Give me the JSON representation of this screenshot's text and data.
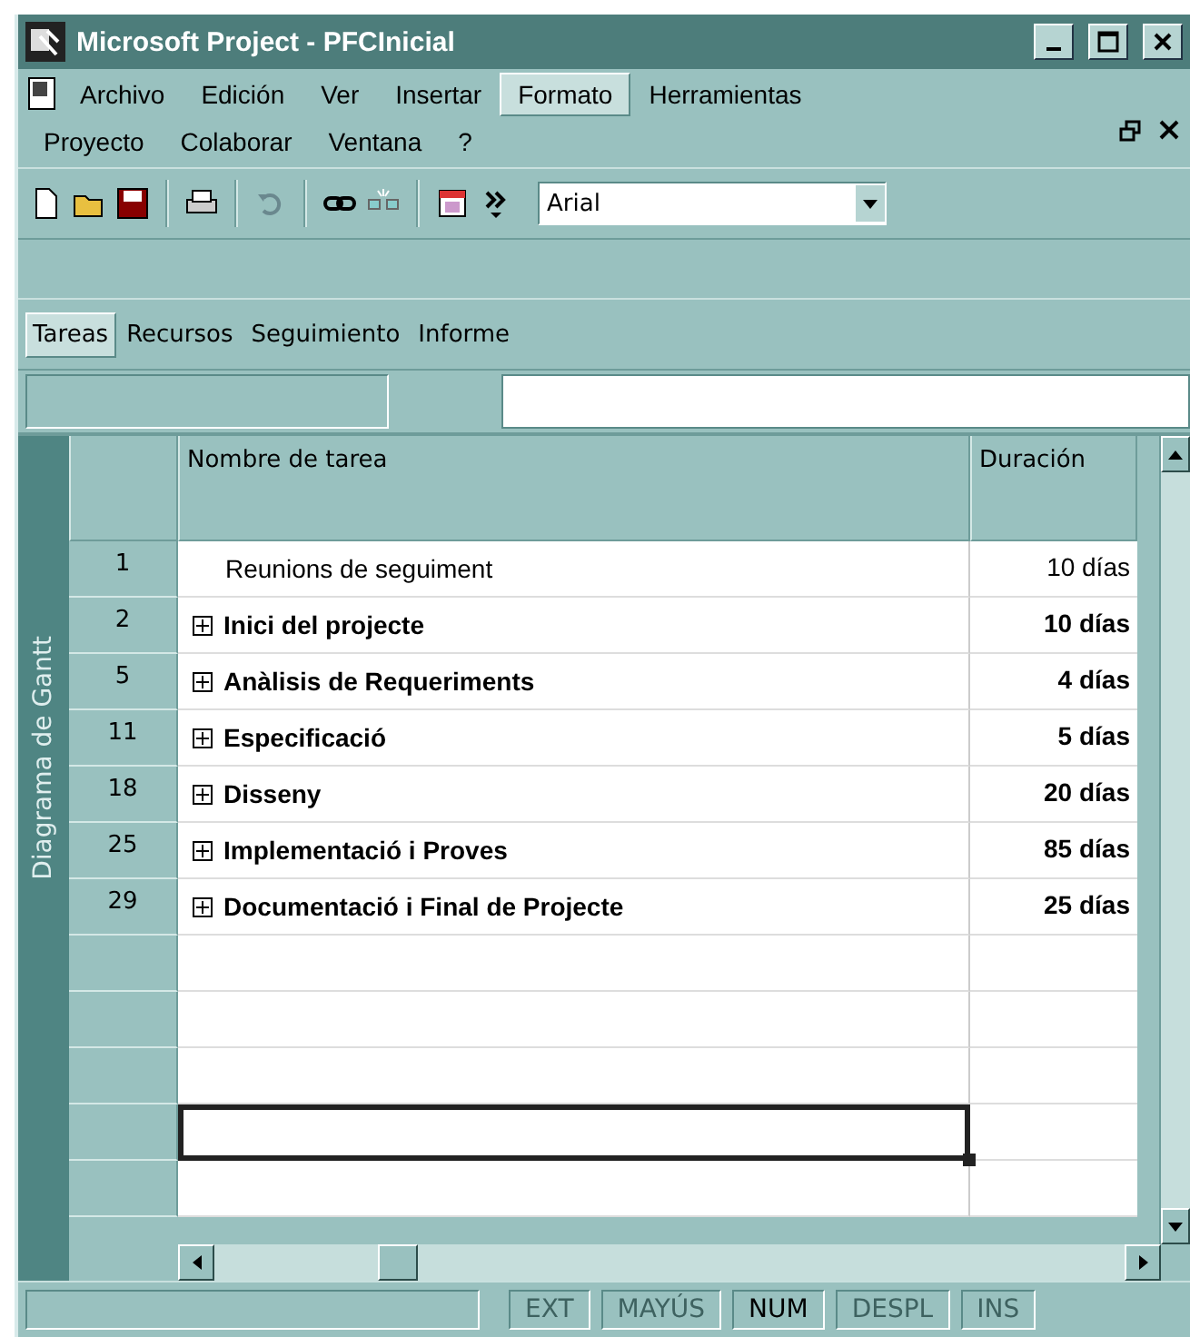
{
  "window": {
    "title": "Microsoft Project - PFCInicial"
  },
  "menu": [
    {
      "label": "Archivo",
      "selected": false
    },
    {
      "label": "Edición",
      "selected": false
    },
    {
      "label": "Ver",
      "selected": false
    },
    {
      "label": "Insertar",
      "selected": false
    },
    {
      "label": "Formato",
      "selected": true
    },
    {
      "label": "Herramientas",
      "selected": false
    },
    {
      "label": "Proyecto",
      "selected": false
    },
    {
      "label": "Colaborar",
      "selected": false
    },
    {
      "label": "Ventana",
      "selected": false
    },
    {
      "label": "?",
      "selected": false
    }
  ],
  "toolbar": {
    "font": "Arial",
    "undo_disabled": true
  },
  "view_bar": [
    {
      "label": "Tareas",
      "selected": true
    },
    {
      "label": "Recursos",
      "selected": false
    },
    {
      "label": "Seguimiento",
      "selected": false
    },
    {
      "label": "Informe",
      "selected": false
    }
  ],
  "side_label": "Diagrama de Gantt",
  "table": {
    "columns": [
      "Nombre de tarea",
      "Duración"
    ],
    "rows": [
      {
        "id": "1",
        "name": "Reunions de seguiment",
        "duration": "10 días",
        "kind": "task",
        "selected": false
      },
      {
        "id": "2",
        "name": "Inici del projecte",
        "duration": "10 días",
        "kind": "summary",
        "selected": false
      },
      {
        "id": "5",
        "name": "Anàlisis de Requeriments",
        "duration": "4 días",
        "kind": "summary",
        "selected": false
      },
      {
        "id": "11",
        "name": "Especificació",
        "duration": "5 días",
        "kind": "summary",
        "selected": false
      },
      {
        "id": "18",
        "name": "Disseny",
        "duration": "20 días",
        "kind": "summary",
        "selected": false
      },
      {
        "id": "25",
        "name": "Implementació i Proves",
        "duration": "85 días",
        "kind": "summary",
        "selected": false
      },
      {
        "id": "29",
        "name": "Documentació i Final de Projecte",
        "duration": "25 días",
        "kind": "summary",
        "selected": false
      },
      {
        "kind": "empty",
        "selected": false
      },
      {
        "kind": "empty",
        "selected": false
      },
      {
        "kind": "empty",
        "selected": false
      },
      {
        "kind": "empty",
        "selected": true
      },
      {
        "kind": "empty",
        "selected": false
      }
    ]
  },
  "status_bar": [
    {
      "label": "EXT",
      "on": false
    },
    {
      "label": "MAYÚS",
      "on": false
    },
    {
      "label": "NUM",
      "on": true
    },
    {
      "label": "DESPL",
      "on": false
    },
    {
      "label": "INS",
      "on": false
    }
  ]
}
